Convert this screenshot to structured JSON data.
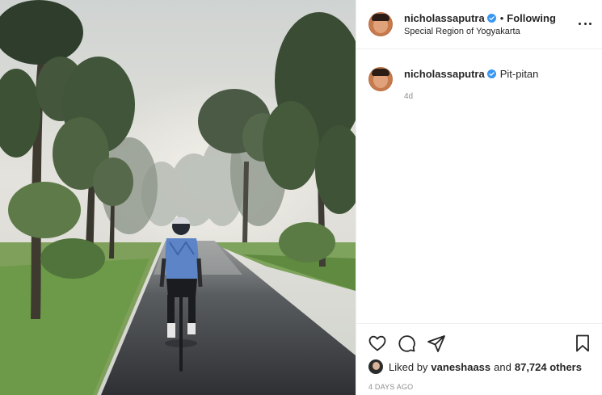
{
  "post": {
    "username": "nicholassaputra",
    "follow_label": "Following",
    "dot_separator": "•",
    "location": "Special Region of Yogyakarta",
    "photo_alt": "Cyclist riding on a misty tree-lined road",
    "caption_text": "Pit-pitan",
    "caption_age": "4d"
  },
  "engagement": {
    "liked_by_prefix": "Liked by",
    "liked_by_user": "vaneshaass",
    "and_label": "and",
    "others_label": "87,724 others",
    "timestamp": "4 DAYS AGO"
  },
  "icons": {
    "verified": "verified-badge-icon",
    "more": "more-options-icon",
    "like": "heart-icon",
    "comment": "comment-icon",
    "share": "share-icon",
    "save": "bookmark-icon"
  },
  "colors": {
    "verified_blue": "#3897f0",
    "text": "#262626",
    "muted": "#8e8e8e",
    "divider": "#efefef"
  }
}
